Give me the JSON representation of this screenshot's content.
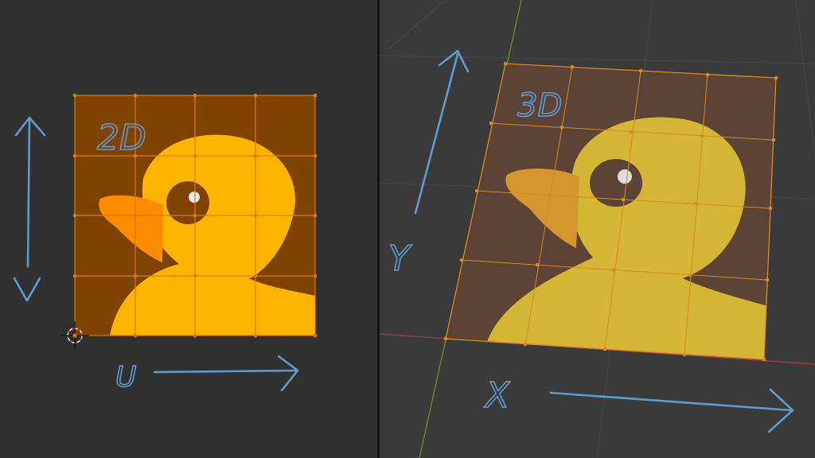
{
  "uv_editor": {
    "mesh_label": "2D",
    "horizontal_axis_label": "U",
    "vertical_axis_label": "",
    "grid": {
      "rows": 4,
      "cols": 4
    },
    "colors": {
      "background": "#313131",
      "mesh_edge": "#e07a10",
      "selected_face": "#7f4300",
      "duck": "#ffb400",
      "beak": "#ff8c00"
    }
  },
  "viewport_3d": {
    "mesh_label": "3D",
    "horizontal_axis_label": "X",
    "vertical_axis_label": "Y",
    "grid": {
      "rows": 4,
      "cols": 4
    },
    "colors": {
      "background": "#3a3a3a",
      "x_axis": "#9a3b3b",
      "y_axis": "#6a8a2a",
      "plane": "#5c4336",
      "duck": "#d4b534",
      "beak": "#d6952e"
    }
  },
  "annotation_color": "#5f9bd0"
}
